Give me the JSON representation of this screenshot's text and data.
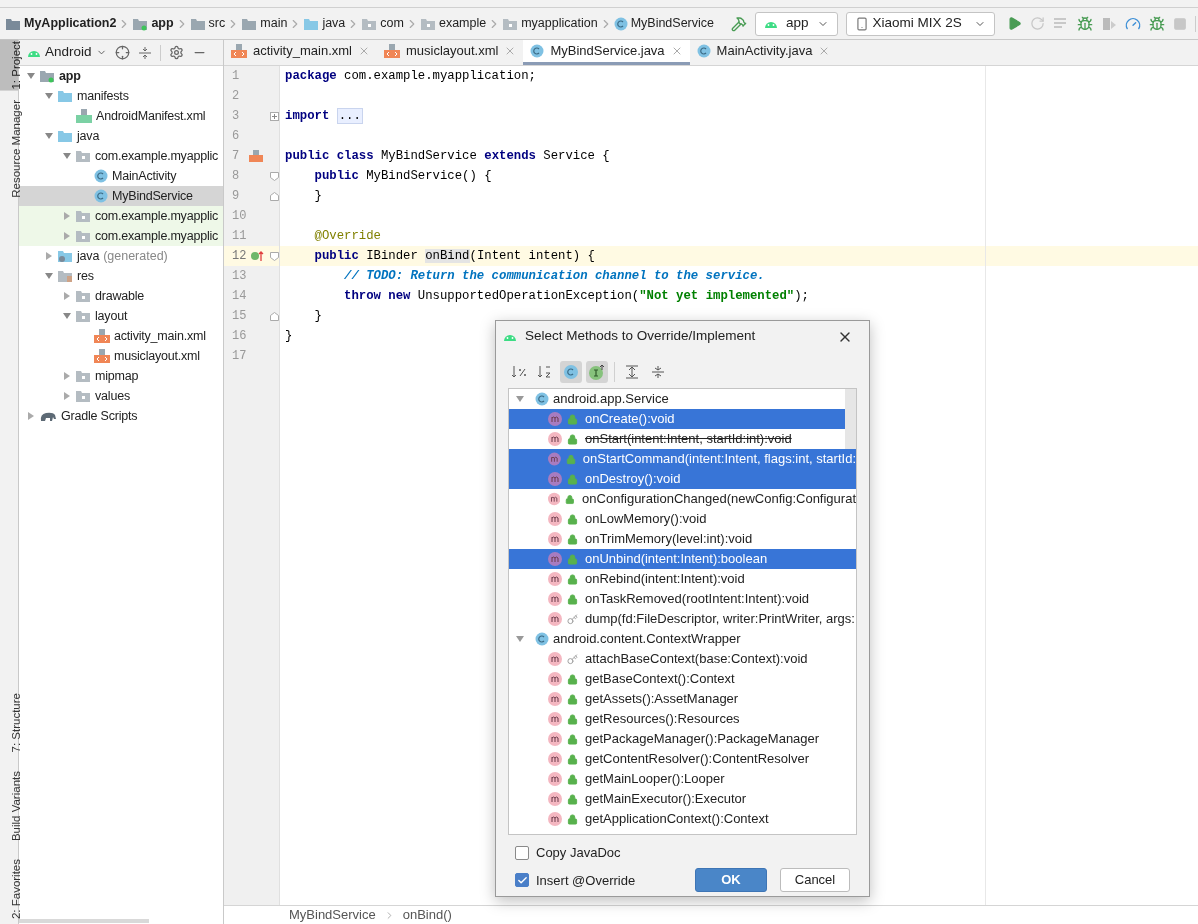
{
  "breadcrumb": [
    {
      "label": "MyApplication2",
      "kind": "project"
    },
    {
      "label": "app",
      "kind": "module"
    },
    {
      "label": "src",
      "kind": "folder"
    },
    {
      "label": "main",
      "kind": "folder"
    },
    {
      "label": "java",
      "kind": "source"
    },
    {
      "label": "com",
      "kind": "package"
    },
    {
      "label": "example",
      "kind": "package"
    },
    {
      "label": "myapplication",
      "kind": "package"
    },
    {
      "label": "MyBindService",
      "kind": "class"
    }
  ],
  "run_config": "app",
  "device": "Xiaomi MIX 2S",
  "left_tools_top": [
    {
      "label": "1: Project",
      "selected": true
    },
    {
      "label": "Resource Manager",
      "selected": false
    }
  ],
  "left_tools_bottom": [
    {
      "label": "7: Structure",
      "selected": false
    },
    {
      "label": "Build Variants",
      "selected": false
    },
    {
      "label": "2: Favorites",
      "selected": false
    }
  ],
  "project_panel": {
    "view": "Android",
    "tree": [
      {
        "label": "app",
        "kind": "module",
        "expanded": true,
        "children": [
          {
            "label": "manifests",
            "kind": "source",
            "expanded": true,
            "children": [
              {
                "label": "AndroidManifest.xml",
                "kind": "manifest"
              }
            ]
          },
          {
            "label": "java",
            "kind": "source",
            "expanded": true,
            "children": [
              {
                "label": "com.example.myapplic",
                "kind": "package",
                "expanded": true,
                "children": [
                  {
                    "label": "MainActivity",
                    "kind": "class",
                    "selected": false
                  },
                  {
                    "label": "MyBindService",
                    "kind": "class",
                    "selected": true
                  }
                ]
              },
              {
                "label": "com.example.myapplic",
                "kind": "test_package",
                "expanded": false
              },
              {
                "label": "com.example.myapplic",
                "kind": "test_package",
                "expanded": false
              }
            ]
          },
          {
            "label": "java",
            "suffix": "(generated)",
            "kind": "generated",
            "expanded": false
          },
          {
            "label": "res",
            "kind": "res",
            "expanded": true,
            "children": [
              {
                "label": "drawable",
                "kind": "package",
                "expanded": false
              },
              {
                "label": "layout",
                "kind": "package",
                "expanded": true,
                "children": [
                  {
                    "label": "activity_main.xml",
                    "kind": "xml"
                  },
                  {
                    "label": "musiclayout.xml",
                    "kind": "xml"
                  }
                ]
              },
              {
                "label": "mipmap",
                "kind": "package",
                "expanded": false
              },
              {
                "label": "values",
                "kind": "package",
                "expanded": false
              }
            ]
          }
        ]
      },
      {
        "label": "Gradle Scripts",
        "kind": "gradle",
        "expanded": false
      }
    ]
  },
  "editor_tabs": [
    {
      "label": "activity_main.xml",
      "kind": "xml",
      "selected": false
    },
    {
      "label": "musiclayout.xml",
      "kind": "xml",
      "selected": false
    },
    {
      "label": "MyBindService.java",
      "kind": "class",
      "selected": true
    },
    {
      "label": "MainActivity.java",
      "kind": "class",
      "selected": false
    }
  ],
  "code": [
    {
      "number": "1",
      "segments": [
        {
          "text": "package",
          "kind": "keyword"
        },
        {
          "text": " com.example.myapplication;",
          "kind": "plain"
        }
      ]
    },
    {
      "number": "2"
    },
    {
      "number": "3",
      "fold": {
        "kind": "collapsed"
      },
      "segments": [
        {
          "text": "import ",
          "kind": "keyword"
        },
        {
          "text": "...",
          "kind": "folded"
        }
      ]
    },
    {
      "number": "6"
    },
    {
      "number": "7",
      "gutter_icon": {
        "kind": "layout"
      },
      "segments": [
        {
          "text": "public class",
          "kind": "keyword"
        },
        {
          "text": " MyBindService ",
          "kind": "plain"
        },
        {
          "text": "extends",
          "kind": "keyword"
        },
        {
          "text": " Service {",
          "kind": "plain"
        }
      ]
    },
    {
      "number": "8",
      "fold": {
        "kind": "open"
      },
      "segments": [
        {
          "text": "    public",
          "kind": "keyword"
        },
        {
          "text": " MyBindService() {",
          "kind": "plain"
        }
      ]
    },
    {
      "number": "9",
      "fold": {
        "kind": "close"
      },
      "segments": [
        {
          "text": "    }",
          "kind": "plain"
        }
      ]
    },
    {
      "number": "10"
    },
    {
      "number": "11",
      "segments": [
        {
          "text": "    @Override",
          "kind": "annotation"
        }
      ]
    },
    {
      "number": "12",
      "current": true,
      "gutter_icon": {
        "kind": "implements"
      },
      "fold": {
        "kind": "open"
      },
      "segments": [
        {
          "text": "    public",
          "kind": "keyword"
        },
        {
          "text": " IBinder ",
          "kind": "plain"
        },
        {
          "text": "onBind",
          "kind": "highlight"
        },
        {
          "text": "(Intent intent) {",
          "kind": "plain"
        }
      ]
    },
    {
      "number": "13",
      "segments": [
        {
          "text": "        // TODO: Return the communication channel to the service.",
          "kind": "todo"
        }
      ]
    },
    {
      "number": "14",
      "segments": [
        {
          "text": "        throw new",
          "kind": "keyword"
        },
        {
          "text": " UnsupportedOperationException(",
          "kind": "plain"
        },
        {
          "text": "\"Not yet implemented\"",
          "kind": "string"
        },
        {
          "text": ");",
          "kind": "plain"
        }
      ]
    },
    {
      "number": "15",
      "fold": {
        "kind": "close"
      },
      "segments": [
        {
          "text": "    }",
          "kind": "plain"
        }
      ]
    },
    {
      "number": "16",
      "segments": [
        {
          "text": "}",
          "kind": "plain"
        }
      ]
    },
    {
      "number": "17"
    }
  ],
  "status_breadcrumb": [
    "MyBindService",
    "onBind()"
  ],
  "dialog": {
    "title": "Select Methods to Override/Implement",
    "toggles": [
      {
        "kind": "sort_visibility",
        "on": false
      },
      {
        "kind": "sort_alpha",
        "on": false
      },
      {
        "kind": "show_classes",
        "on": true
      },
      {
        "kind": "show_interfaces",
        "on": true
      },
      {
        "kind": "expand_all",
        "on": false
      },
      {
        "kind": "collapse_all",
        "on": false
      }
    ],
    "groups": [
      {
        "label": "android.app.Service",
        "expanded": true,
        "methods": [
          {
            "label": "onCreate():void",
            "selected": true,
            "kind": "public",
            "deprecated": false
          },
          {
            "label": "onStart(intent:Intent, startId:int):void",
            "selected": false,
            "kind": "public",
            "deprecated": true
          },
          {
            "label": "onStartCommand(intent:Intent, flags:int, startId:",
            "selected": true,
            "kind": "public",
            "deprecated": false
          },
          {
            "label": "onDestroy():void",
            "selected": true,
            "kind": "public",
            "deprecated": false
          },
          {
            "label": "onConfigurationChanged(newConfig:Configurat",
            "selected": false,
            "kind": "public",
            "deprecated": false
          },
          {
            "label": "onLowMemory():void",
            "selected": false,
            "kind": "public",
            "deprecated": false
          },
          {
            "label": "onTrimMemory(level:int):void",
            "selected": false,
            "kind": "public",
            "deprecated": false
          },
          {
            "label": "onUnbind(intent:Intent):boolean",
            "selected": true,
            "kind": "public",
            "deprecated": false
          },
          {
            "label": "onRebind(intent:Intent):void",
            "selected": false,
            "kind": "public",
            "deprecated": false
          },
          {
            "label": "onTaskRemoved(rootIntent:Intent):void",
            "selected": false,
            "kind": "public",
            "deprecated": false
          },
          {
            "label": "dump(fd:FileDescriptor, writer:PrintWriter, args:",
            "selected": false,
            "kind": "protected",
            "deprecated": false
          }
        ]
      },
      {
        "label": "android.content.ContextWrapper",
        "expanded": true,
        "methods": [
          {
            "label": "attachBaseContext(base:Context):void",
            "selected": false,
            "kind": "protected",
            "deprecated": false
          },
          {
            "label": "getBaseContext():Context",
            "selected": false,
            "kind": "public",
            "deprecated": false
          },
          {
            "label": "getAssets():AssetManager",
            "selected": false,
            "kind": "public",
            "deprecated": false
          },
          {
            "label": "getResources():Resources",
            "selected": false,
            "kind": "public",
            "deprecated": false
          },
          {
            "label": "getPackageManager():PackageManager",
            "selected": false,
            "kind": "public",
            "deprecated": false
          },
          {
            "label": "getContentResolver():ContentResolver",
            "selected": false,
            "kind": "public",
            "deprecated": false
          },
          {
            "label": "getMainLooper():Looper",
            "selected": false,
            "kind": "public",
            "deprecated": false
          },
          {
            "label": "getMainExecutor():Executor",
            "selected": false,
            "kind": "public",
            "deprecated": false
          },
          {
            "label": "getApplicationContext():Context",
            "selected": false,
            "kind": "public",
            "deprecated": false
          }
        ]
      }
    ],
    "options": [
      {
        "label": "Copy JavaDoc",
        "checked": false
      },
      {
        "label": "Insert @Override",
        "checked": true
      }
    ],
    "buttons": [
      {
        "label": "OK",
        "kind": "primary"
      },
      {
        "label": "Cancel",
        "kind": "secondary"
      }
    ]
  }
}
